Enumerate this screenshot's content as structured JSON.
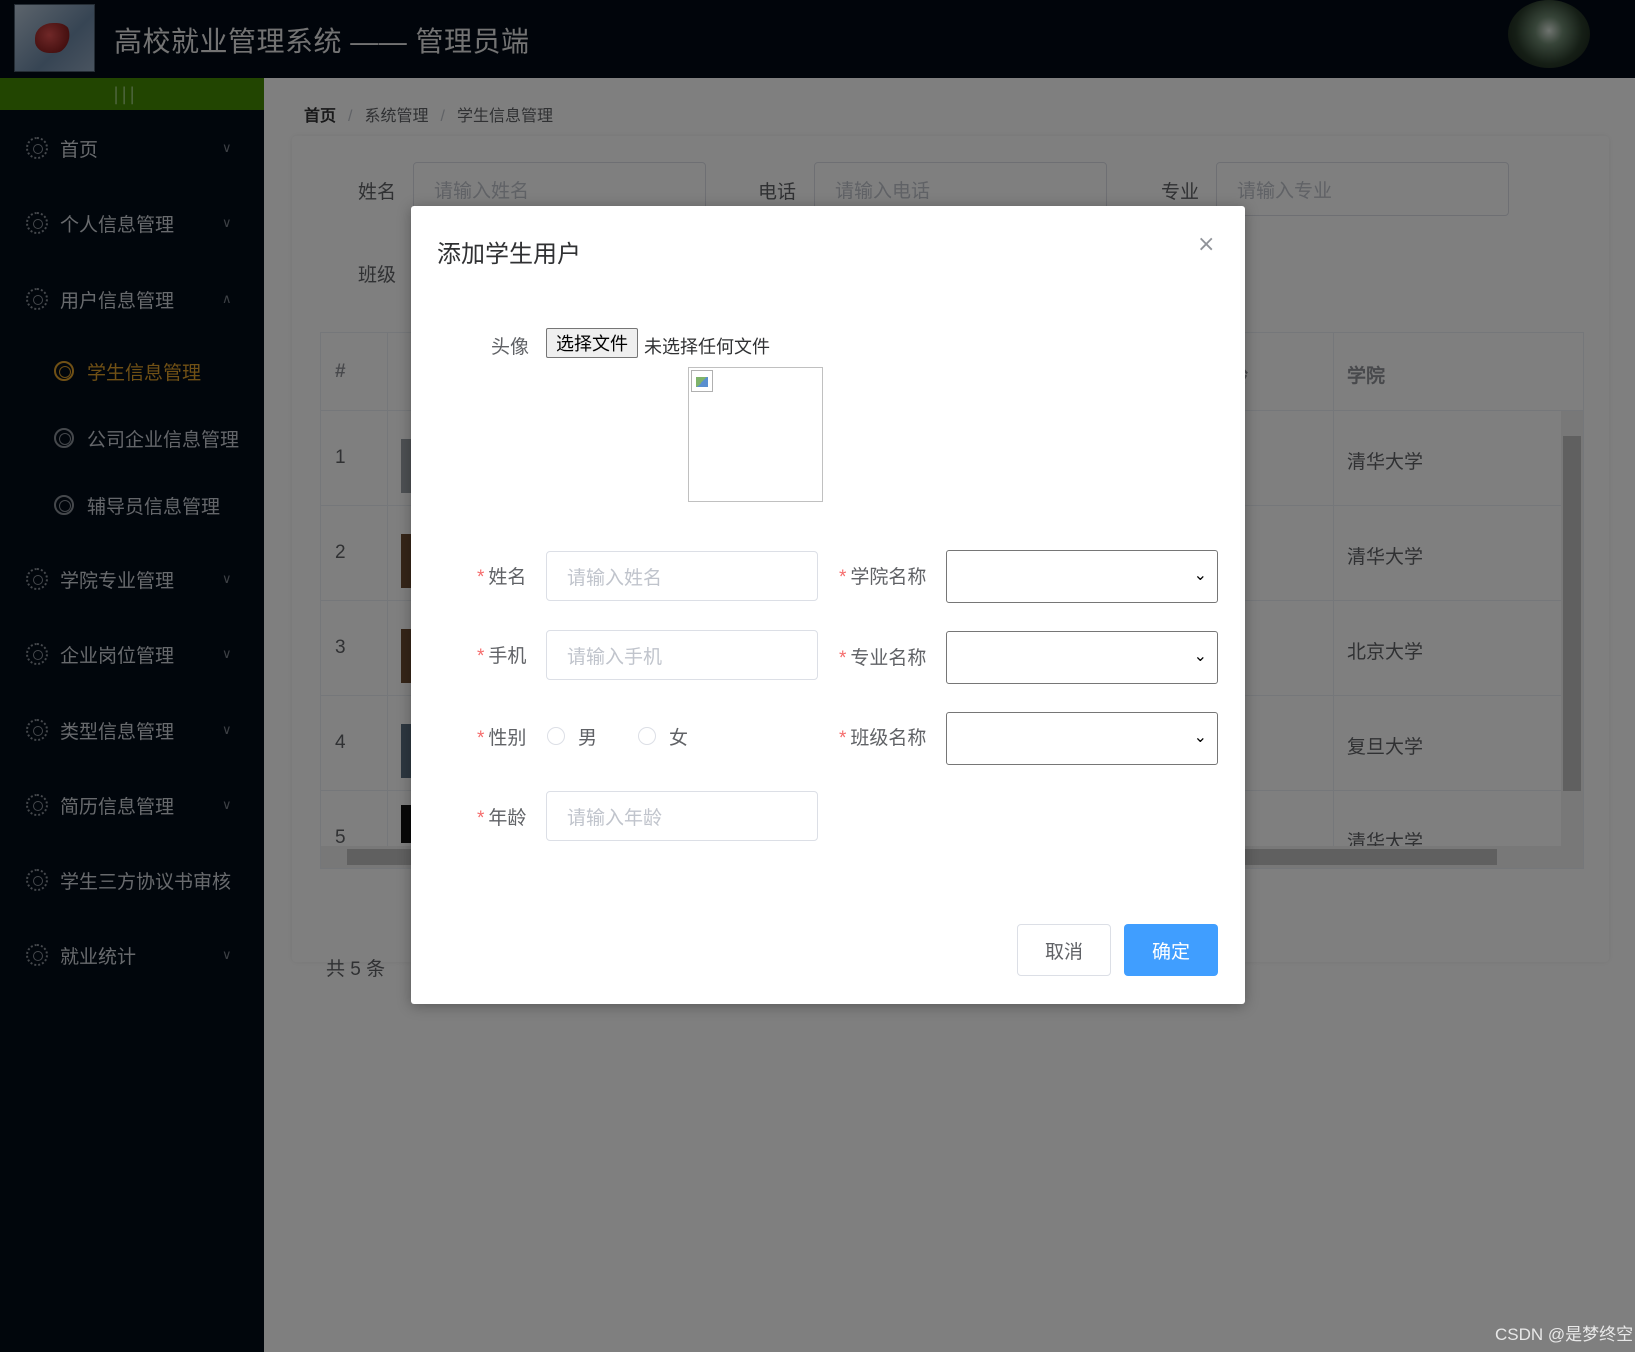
{
  "header": {
    "title": "高校就业管理系统 —— 管理员端"
  },
  "sidebar": {
    "collapse_icon": "|||",
    "items": [
      {
        "label": "首页",
        "chevron": "∨"
      },
      {
        "label": "个人信息管理",
        "chevron": "∨"
      },
      {
        "label": "用户信息管理",
        "chevron": "∧"
      },
      {
        "label": "学院专业管理",
        "chevron": "∨"
      },
      {
        "label": "企业岗位管理",
        "chevron": "∨"
      },
      {
        "label": "类型信息管理",
        "chevron": "∨"
      },
      {
        "label": "简历信息管理",
        "chevron": "∨"
      },
      {
        "label": "学生三方协议书审核",
        "chevron": ""
      },
      {
        "label": "就业统计",
        "chevron": "∨"
      }
    ],
    "sub_items": [
      {
        "label": "学生信息管理",
        "active": true
      },
      {
        "label": "公司企业信息管理",
        "active": false
      },
      {
        "label": "辅导员信息管理",
        "active": false
      }
    ]
  },
  "breadcrumb": {
    "home": "首页",
    "level1": "系统管理",
    "level2": "学生信息管理",
    "separator": "/"
  },
  "search": {
    "name_label": "姓名",
    "name_placeholder": "请输入姓名",
    "phone_label": "电话",
    "phone_placeholder": "请输入电话",
    "major_label": "专业",
    "major_placeholder": "请输入专业",
    "class_label": "班级"
  },
  "table": {
    "headers": {
      "index": "#",
      "age": "龄",
      "school": "学院"
    },
    "rows": [
      {
        "index": "1",
        "school": "清华大学"
      },
      {
        "index": "2",
        "school": "清华大学"
      },
      {
        "index": "3",
        "school": "北京大学"
      },
      {
        "index": "4",
        "school": "复旦大学"
      },
      {
        "index": "5",
        "school": "清华大学"
      }
    ],
    "total": "共 5 条"
  },
  "dialog": {
    "title": "添加学生用户",
    "close_icon": "×",
    "avatar_label": "头像",
    "file_button": "选择文件",
    "file_status": "未选择任何文件",
    "required_mark": "*",
    "name_label": "姓名",
    "name_placeholder": "请输入姓名",
    "phone_label": "手机",
    "phone_placeholder": "请输入手机",
    "gender_label": "性别",
    "gender_male": "男",
    "gender_female": "女",
    "age_label": "年龄",
    "age_placeholder": "请输入年龄",
    "college_label": "学院名称",
    "major_label": "专业名称",
    "class_label": "班级名称",
    "select_arrow": "⌄",
    "cancel": "取消",
    "confirm": "确定"
  },
  "watermark": "CSDN @是梦终空",
  "colors": {
    "header_bg": "#030b17",
    "sidebar_bg": "#020c19",
    "collapse_bar": "#448a02",
    "active_menu": "#e0a12a",
    "primary_button": "#409eff",
    "required": "#f56c6c"
  }
}
